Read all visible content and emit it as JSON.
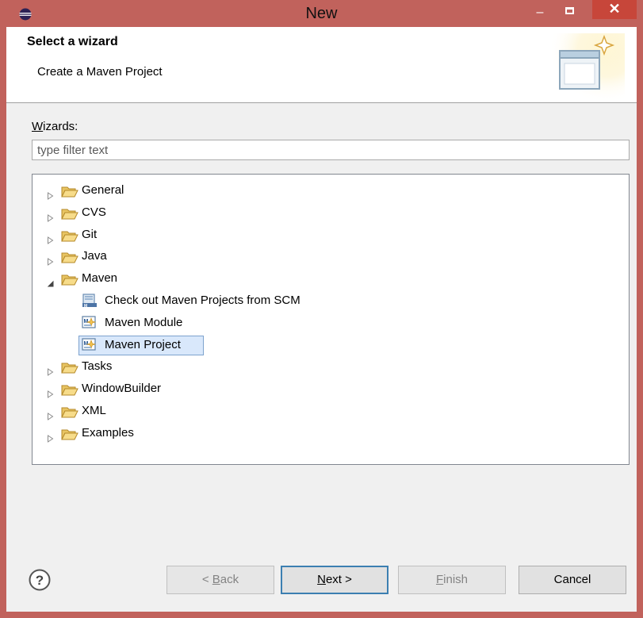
{
  "window": {
    "title": "New",
    "minimize_glyph": "–",
    "close_glyph": "✕",
    "accent_color": "#c1625c"
  },
  "header": {
    "title": "Select a wizard",
    "description": "Create a Maven Project"
  },
  "wizards_label": {
    "mnemonic": "W",
    "rest": "izards:"
  },
  "filter": {
    "placeholder": "type filter text",
    "value": ""
  },
  "tree": {
    "items": [
      {
        "label": "General",
        "expanded": false
      },
      {
        "label": "CVS",
        "expanded": false
      },
      {
        "label": "Git",
        "expanded": false
      },
      {
        "label": "Java",
        "expanded": false
      },
      {
        "label": "Maven",
        "expanded": true
      },
      {
        "label": "Tasks",
        "expanded": false
      },
      {
        "label": "WindowBuilder",
        "expanded": false
      },
      {
        "label": "XML",
        "expanded": false
      },
      {
        "label": "Examples",
        "expanded": false
      }
    ],
    "maven_children": [
      {
        "label": "Check out Maven Projects from SCM",
        "icon": "scm-checkout-icon"
      },
      {
        "label": "Maven Module",
        "icon": "maven-module-icon"
      },
      {
        "label": "Maven Project",
        "icon": "maven-project-icon",
        "selected": true
      }
    ]
  },
  "buttons": {
    "back": {
      "mnemonic": "B",
      "prefix": "< ",
      "rest": "ack",
      "enabled": false
    },
    "next": {
      "mnemonic": "N",
      "rest": "ext >",
      "enabled": true
    },
    "finish": {
      "mnemonic": "F",
      "rest": "inish",
      "enabled": false
    },
    "cancel": {
      "label": "Cancel",
      "enabled": true
    }
  },
  "help_icon": "question-mark-icon"
}
